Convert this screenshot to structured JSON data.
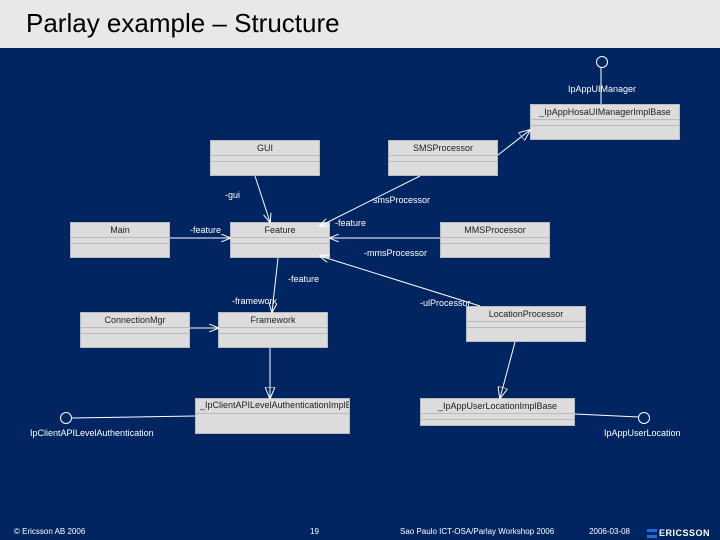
{
  "slide": {
    "title": "Parlay example – Structure"
  },
  "nodes": {
    "ipAppUIManager": "IpAppUIManager",
    "ipAppHosaUIManagerImplBase": "_IpAppHosaUIManagerImplBase",
    "gui": "GUI",
    "smsProcessor": "SMSProcessor",
    "main": "Main",
    "feature": "Feature",
    "mmsProcessor": "MMSProcessor",
    "connectionMgr": "ConnectionMgr",
    "framework": "Framework",
    "locationProcessor": "LocationProcessor",
    "ipClientAPILevelAuthImplBase": "_IpClientAPILevelAuthenticationImplBase",
    "ipAppUserLocationImplBase": "_IpAppUserLocationImplBase",
    "ipClientAPILevelAuth": "IpClientAPILevelAuthentication",
    "ipAppUserLocation": "IpAppUserLocation"
  },
  "roles": {
    "gui": "-gui",
    "smsProcessor": "-smsProcessor",
    "feature1": "-feature",
    "feature2": "-feature",
    "feature3": "-feature",
    "mmsProcessor": "-mmsProcessor",
    "framework": "-framework",
    "ulProcessor": "-ulProcessor"
  },
  "footer": {
    "copyright": "© Ericsson AB 2006",
    "page": "19",
    "venue": "Sao Paulo ICT-OSA/Parlay Workshop 2006",
    "date": "2006-03-08",
    "logo": "ERICSSON"
  }
}
